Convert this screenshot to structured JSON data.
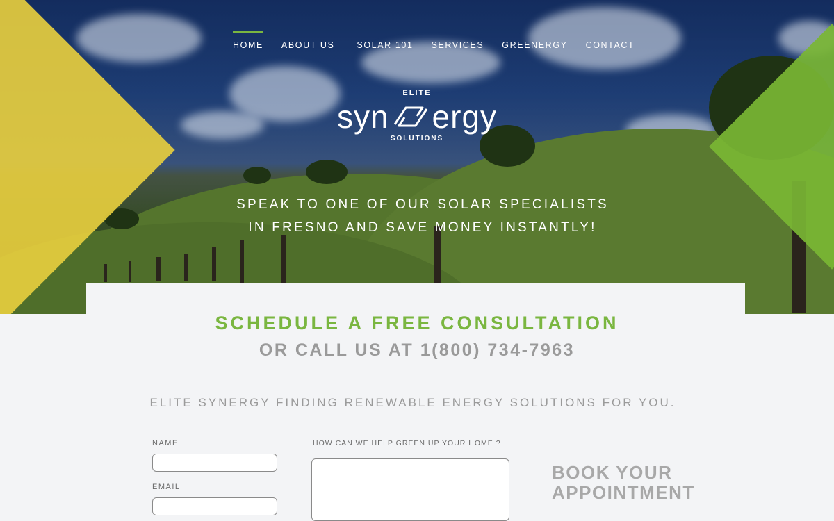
{
  "nav": {
    "items": [
      {
        "label": "HOME",
        "active": true
      },
      {
        "label": "ABOUT US",
        "active": false
      },
      {
        "label": "SOLAR 101",
        "active": false
      },
      {
        "label": "SERVICES",
        "active": false
      },
      {
        "label": "GREENERGY",
        "active": false
      },
      {
        "label": "CONTACT",
        "active": false
      }
    ]
  },
  "logo": {
    "top": "ELITE",
    "left_text": "syn",
    "right_text": "ergy",
    "bottom": "SOLUTIONS"
  },
  "hero": {
    "tagline_line1": "SPEAK TO ONE OF OUR SOLAR SPECIALISTS",
    "tagline_line2": "IN FRESNO AND SAVE MONEY INSTANTLY!"
  },
  "cta": {
    "title": "SCHEDULE A FREE CONSULTATION",
    "call_prefix": "OR CALL US AT",
    "phone": "1(800) 734-7963"
  },
  "subtitle": "ELITE SYNERGY FINDING RENEWABLE ENERGY SOLUTIONS FOR YOU.",
  "form": {
    "name_label": "NAME",
    "name_value": "",
    "email_label": "EMAIL",
    "email_value": "",
    "message_label": "HOW CAN WE HELP GREEN UP YOUR HOME ?",
    "message_value": ""
  },
  "book": {
    "line1": "BOOK YOUR",
    "line2": "APPOINTMENT"
  },
  "colors": {
    "accent_green": "#7ab640",
    "accent_yellow": "#e6cd3e",
    "text_gray": "#9a9a9a",
    "background": "#f3f4f6"
  }
}
